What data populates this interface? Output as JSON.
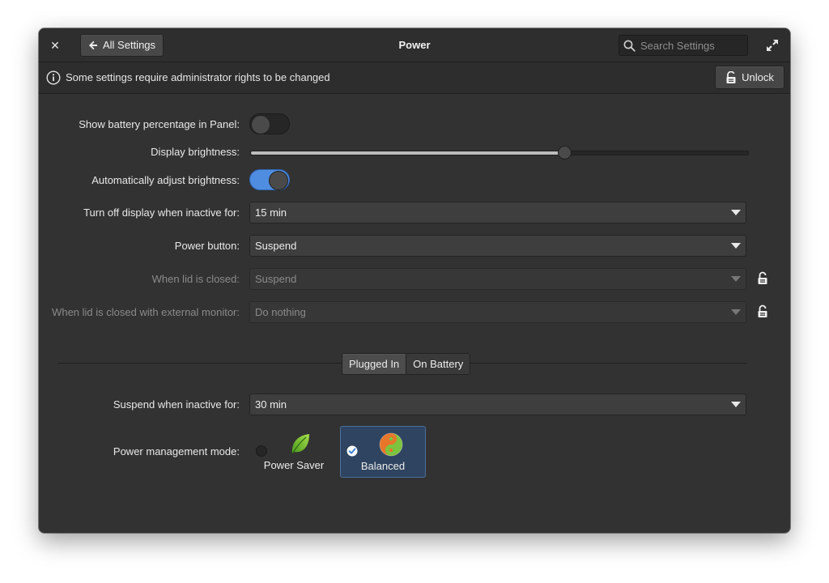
{
  "window": {
    "title": "Power",
    "back_label": "All Settings",
    "search_placeholder": "Search Settings"
  },
  "infobar": {
    "message": "Some settings require administrator rights to be changed",
    "unlock_label": "Unlock"
  },
  "settings": {
    "battery_percentage": {
      "label": "Show battery percentage in Panel:",
      "enabled": false
    },
    "brightness": {
      "label": "Display brightness:",
      "level_percent": 63
    },
    "auto_brightness": {
      "label": "Automatically adjust brightness:",
      "enabled": true
    },
    "display_off": {
      "label": "Turn off display when inactive for:",
      "value": "15 min"
    },
    "power_button": {
      "label": "Power button:",
      "value": "Suspend"
    },
    "lid_closed": {
      "label": "When lid is closed:",
      "value": "Suspend",
      "locked": true
    },
    "lid_closed_external": {
      "label": "When lid is closed with external monitor:",
      "value": "Do nothing",
      "locked": true
    }
  },
  "tabs": [
    {
      "label": "Plugged In",
      "active": true
    },
    {
      "label": "On Battery",
      "active": false
    }
  ],
  "suspend": {
    "label": "Suspend when inactive for:",
    "value": "30 min"
  },
  "power_mode": {
    "label": "Power management mode:",
    "options": [
      {
        "label": "Power Saver",
        "icon": "leaf-icon",
        "selected": false
      },
      {
        "label": "Balanced",
        "icon": "yin-yang-icon",
        "selected": true
      }
    ]
  },
  "colors": {
    "accent": "#4f8de0",
    "window_bg": "#323232",
    "selected_mode_bg": "#2f4460"
  }
}
